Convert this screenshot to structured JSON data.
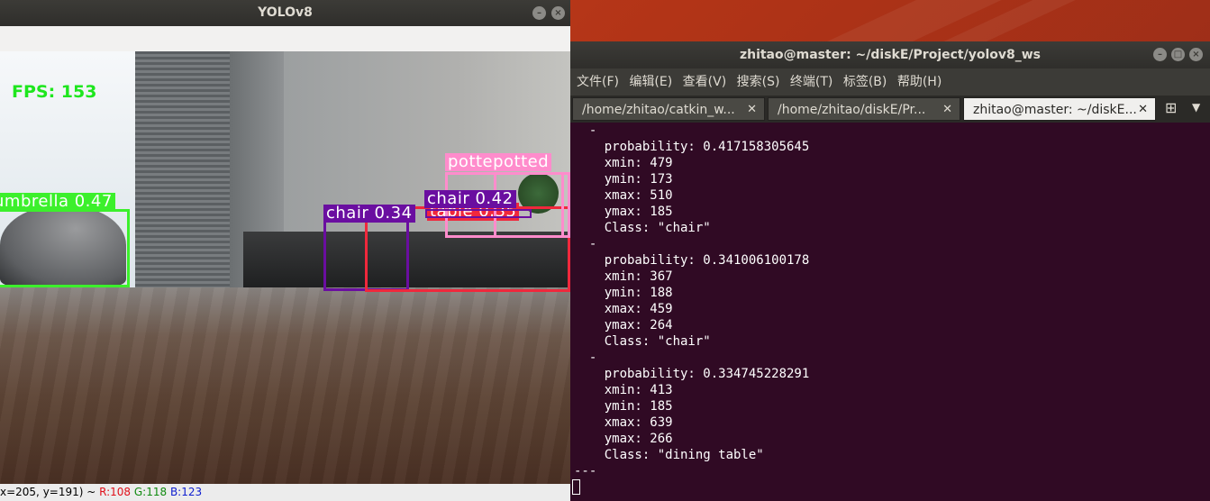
{
  "yolo_window": {
    "title": "YOLOv8",
    "fps_text": "FPS: 153",
    "detections": [
      {
        "label": "umbrella 0.47",
        "color": "#3cf02c"
      },
      {
        "label": "chair 0.34",
        "color": "#6a0ea0"
      },
      {
        "label": "table 0.35",
        "color": "#f0283c"
      },
      {
        "label": "chair 0.42",
        "color": "#6a0ea0"
      },
      {
        "label": "pottepotted",
        "color": "#ff8ccc"
      }
    ],
    "status_prefix": "x=205, y=191) ~ ",
    "status_r": "R:108",
    "status_g": "G:118",
    "status_b": "B:123"
  },
  "terminal": {
    "title": "zhitao@master: ~/diskE/Project/yolov8_ws",
    "menu": [
      "文件(F)",
      "编辑(E)",
      "查看(V)",
      "搜索(S)",
      "终端(T)",
      "标签(B)",
      "帮助(H)"
    ],
    "tabs": [
      {
        "label": "/home/zhitao/catkin_w..."
      },
      {
        "label": "/home/zhitao/diskE/Pr..."
      },
      {
        "label": "zhitao@master: ~/diskE..."
      }
    ],
    "lines": [
      "  -",
      "    probability: 0.417158305645",
      "    xmin: 479",
      "    ymin: 173",
      "    xmax: 510",
      "    ymax: 185",
      "    Class: \"chair\"",
      "  -",
      "    probability: 0.341006100178",
      "    xmin: 367",
      "    ymin: 188",
      "    xmax: 459",
      "    ymax: 264",
      "    Class: \"chair\"",
      "  -",
      "    probability: 0.334745228291",
      "    xmin: 413",
      "    ymin: 185",
      "    xmax: 639",
      "    ymax: 266",
      "    Class: \"dining table\"",
      "---"
    ]
  }
}
